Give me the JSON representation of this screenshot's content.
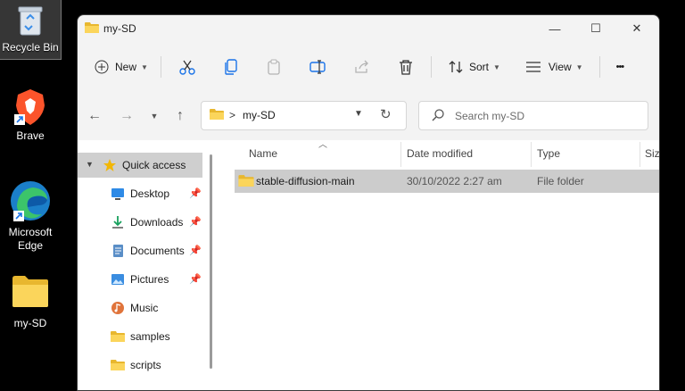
{
  "desktop": {
    "icons": [
      {
        "label": "Recycle Bin",
        "icon": "recycle-bin-icon"
      },
      {
        "label": "Brave",
        "icon": "brave-icon"
      },
      {
        "label": "Microsoft Edge",
        "icon": "edge-icon"
      },
      {
        "label": "my-SD",
        "icon": "folder-icon"
      }
    ]
  },
  "window": {
    "title": "my-SD",
    "controls": {
      "minimize": "—",
      "maximize": "☐",
      "close": "✕"
    }
  },
  "toolbar": {
    "new_label": "New",
    "sort_label": "Sort",
    "view_label": "View",
    "more_label": "•••"
  },
  "address": {
    "separator": ">",
    "path": "my-SD"
  },
  "search": {
    "placeholder": "Search my-SD"
  },
  "nav": {
    "items": [
      {
        "label": "Quick access",
        "icon": "star-icon"
      },
      {
        "label": "Desktop",
        "icon": "desktop-icon"
      },
      {
        "label": "Downloads",
        "icon": "download-icon"
      },
      {
        "label": "Documents",
        "icon": "documents-icon"
      },
      {
        "label": "Pictures",
        "icon": "pictures-icon"
      },
      {
        "label": "Music",
        "icon": "music-icon"
      },
      {
        "label": "samples",
        "icon": "folder-icon"
      },
      {
        "label": "scripts",
        "icon": "folder-icon"
      }
    ]
  },
  "list": {
    "headers": {
      "name": "Name",
      "date": "Date modified",
      "type": "Type",
      "size": "Size"
    },
    "rows": [
      {
        "name": "stable-diffusion-main",
        "date": "30/10/2022 2:27 am",
        "type": "File folder"
      }
    ]
  },
  "colors": {
    "folder": "#f4c542",
    "selection": "#cccccc",
    "accent": "#1a73e8"
  }
}
